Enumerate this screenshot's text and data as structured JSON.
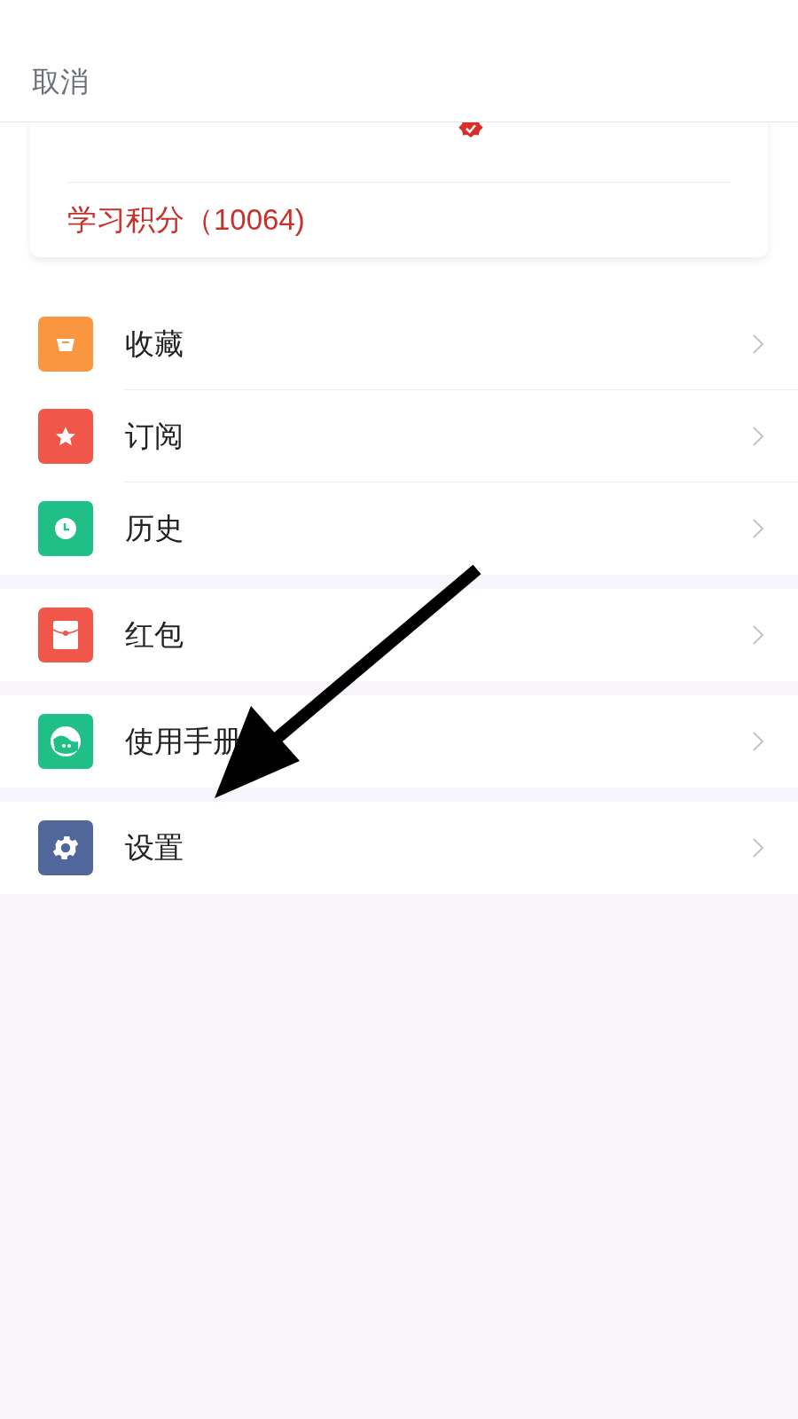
{
  "header": {
    "cancel": "取消"
  },
  "profile_card": {
    "verified": true,
    "points": "学习积分（10064)"
  },
  "menu_groups": [
    {
      "items": [
        {
          "label": "收藏",
          "kind": "box",
          "color": "#fa9540"
        },
        {
          "label": "订阅",
          "kind": "star",
          "color": "#f0574a"
        },
        {
          "label": "历史",
          "kind": "clock",
          "color": "#1fbf87"
        }
      ]
    },
    {
      "items": [
        {
          "label": "红包",
          "kind": "envelope",
          "color": "#f0574a"
        }
      ]
    },
    {
      "items": [
        {
          "label": "使用手册",
          "kind": "headset",
          "color": "#1fbf87"
        }
      ]
    },
    {
      "items": [
        {
          "label": "设置",
          "kind": "gear",
          "color": "#51669a"
        }
      ]
    }
  ]
}
